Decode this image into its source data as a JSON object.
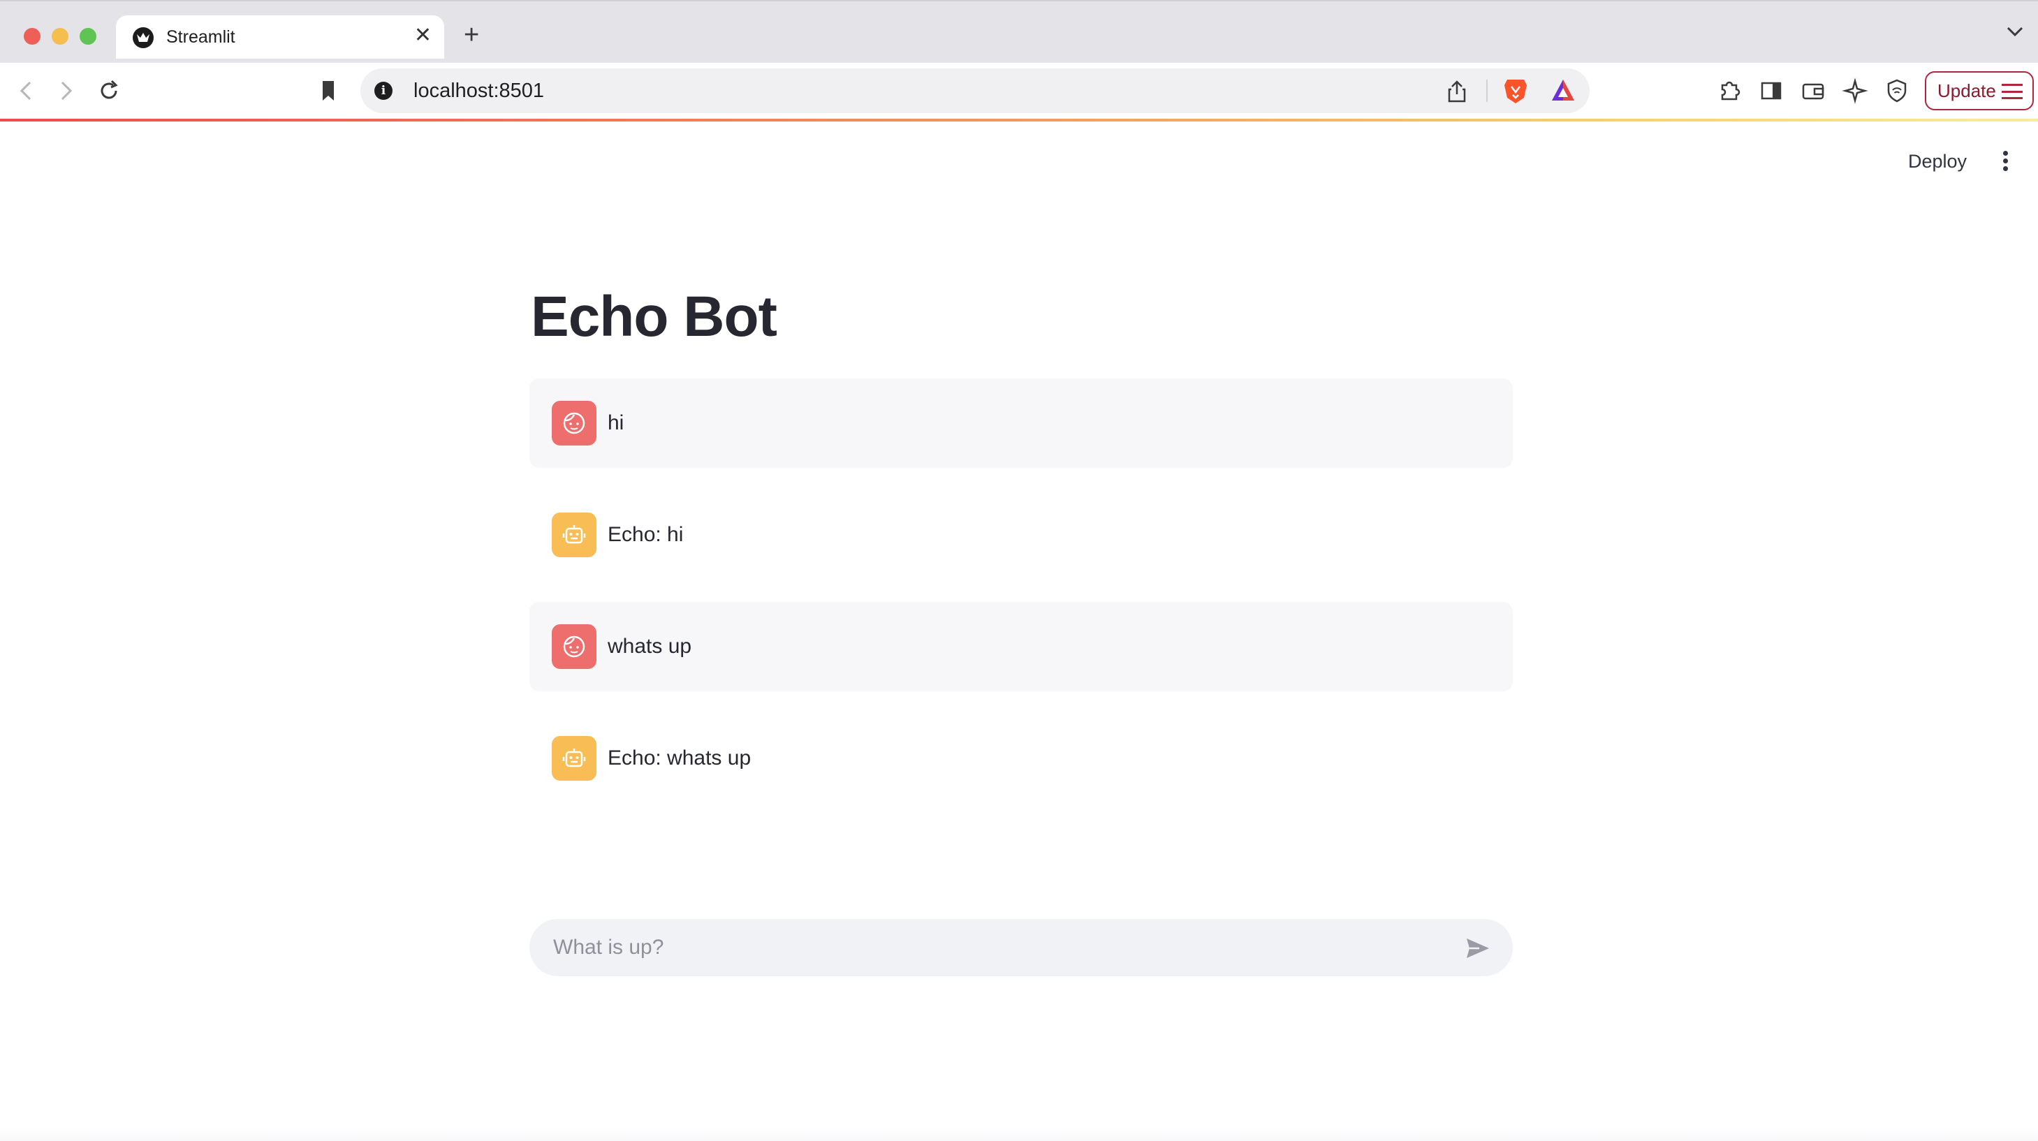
{
  "browser": {
    "tab": {
      "title": "Streamlit",
      "favicon": "streamlit-crown-icon",
      "close_glyph": "✕"
    },
    "new_tab_glyph": "+",
    "address": {
      "url": "localhost:8501"
    },
    "update_label": "Update",
    "accent_colors": [
      "#ef4b4b",
      "#f5d36a"
    ]
  },
  "app": {
    "header": {
      "deploy_label": "Deploy"
    },
    "title": "Echo Bot",
    "messages": [
      {
        "role": "user",
        "avatar": "user-face-icon",
        "text": "hi"
      },
      {
        "role": "assistant",
        "avatar": "robot-icon",
        "text": "Echo: hi"
      },
      {
        "role": "user",
        "avatar": "user-face-icon",
        "text": "whats up"
      },
      {
        "role": "assistant",
        "avatar": "robot-icon",
        "text": "Echo: whats up"
      }
    ],
    "chat_input": {
      "placeholder": "What is up?",
      "value": ""
    },
    "colors": {
      "user_avatar": "#ee6d6d",
      "bot_avatar": "#f8bd54",
      "user_bubble": "#f7f7f9",
      "input_bg": "#f0f2f6"
    }
  }
}
